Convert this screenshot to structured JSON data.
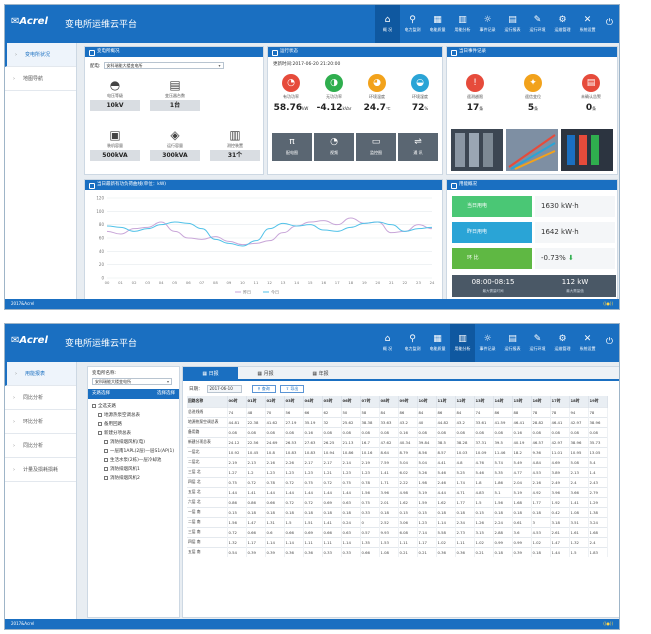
{
  "app": {
    "logo": "Acrel",
    "title": "变电所运维云平台",
    "footer": "2017&Acrel"
  },
  "nav": [
    {
      "label": "概 况",
      "icon": "⌂"
    },
    {
      "label": "电力监测",
      "icon": "⚲"
    },
    {
      "label": "电能质量",
      "icon": "▦"
    },
    {
      "label": "用能分析",
      "icon": "▥"
    },
    {
      "label": "事件记录",
      "icon": "☼"
    },
    {
      "label": "运行报表",
      "icon": "▤"
    },
    {
      "label": "运行环境",
      "icon": "✎"
    },
    {
      "label": "运维管理",
      "icon": "⚙"
    },
    {
      "label": "系统设置",
      "icon": "✕"
    }
  ],
  "screen1": {
    "sidebar": [
      {
        "label": "变电所状况"
      },
      {
        "label": "地图导航"
      }
    ],
    "overview": {
      "title": "变电所概况",
      "room_label": "配电:",
      "room_value": "安科瑞能大楼变电所",
      "items": [
        {
          "label": "电压等级",
          "value": "10kV"
        },
        {
          "label": "变压器台数",
          "value": "1台"
        },
        {
          "label": "装机容量",
          "value": "500kVA"
        },
        {
          "label": "运行容量",
          "value": "300kVA"
        },
        {
          "label": "测控装置",
          "value": "31个"
        }
      ]
    },
    "running": {
      "title": "运行状态",
      "time_label": "更新时间:",
      "time_value": "2017-06-20 21:20:00",
      "metrics": [
        {
          "label": "有功功率",
          "value": "58.76",
          "unit": "kW",
          "color": "#e64b3b"
        },
        {
          "label": "无功功率",
          "value": "-4.12",
          "unit": "kVar",
          "color": "#2fae4e"
        },
        {
          "label": "环境温度",
          "value": "24.7",
          "unit": "℃",
          "color": "#f2a21b"
        },
        {
          "label": "环境湿度",
          "value": "72",
          "unit": "%",
          "color": "#2aa4d6"
        }
      ],
      "tiles": [
        {
          "label": "配电图",
          "icon": "π"
        },
        {
          "label": "视频",
          "icon": "◔"
        },
        {
          "label": "监控图",
          "icon": "▭"
        },
        {
          "label": "通 讯",
          "icon": "⇌"
        }
      ]
    },
    "events": {
      "title": "当日事件记录",
      "items": [
        {
          "label": "遥测越限",
          "value": "17",
          "unit": "条",
          "color": "#e64b3b"
        },
        {
          "label": "遥信变位",
          "value": "5",
          "unit": "条",
          "color": "#f2a21b"
        },
        {
          "label": "未确认告警",
          "value": "0",
          "unit": "条",
          "color": "#e64b3b"
        }
      ]
    },
    "load_chart": {
      "title": "当日最新有功负荷曲线(单位：kW)"
    },
    "chart_data": {
      "type": "line",
      "x": [
        "00",
        "01",
        "02",
        "03",
        "04",
        "05",
        "06",
        "07",
        "08",
        "09",
        "10",
        "11",
        "12",
        "13",
        "14",
        "15",
        "16",
        "17",
        "18",
        "19",
        "20",
        "21",
        "22",
        "23",
        "24"
      ],
      "ylim": [
        0,
        120
      ],
      "yticks": [
        0,
        20,
        40,
        60,
        80,
        100,
        120
      ],
      "series": [
        {
          "name": "昨日",
          "color": "#c8a6d8",
          "values": [
            70,
            66,
            74,
            76,
            84,
            70,
            60,
            58,
            62,
            55,
            50,
            52,
            56,
            68,
            78,
            84,
            86,
            80,
            90,
            82,
            84,
            68,
            70,
            80,
            74
          ]
        },
        {
          "name": "今日",
          "color": "#52c2e8",
          "values": [
            78,
            76,
            70,
            74,
            80,
            84,
            82,
            74,
            58,
            52,
            48,
            56,
            74,
            82,
            78,
            80,
            72,
            70,
            76,
            82,
            84,
            80,
            70,
            74,
            76
          ]
        }
      ],
      "legend_position": "bottom"
    },
    "energy": {
      "title": "用能概况",
      "today_label": "当日用电",
      "today_value": "1630 kW·h",
      "yesterday_label": "昨日用电",
      "yesterday_value": "1642 kW·h",
      "ratio_label": "环 比",
      "ratio_value": "-0.73%",
      "peak_time": "08:00-08:15",
      "peak_time_label": "最大需量时间",
      "peak_value": "112 kW",
      "peak_value_label": "最大需量值"
    }
  },
  "screen2": {
    "sidebar": [
      {
        "label": "用能报表"
      },
      {
        "label": "同比分析"
      },
      {
        "label": "环比分析"
      },
      {
        "label": "同比分析"
      },
      {
        "label": "计量及损耗损耗"
      }
    ],
    "tree": {
      "room_label": "变电所名称:",
      "room_value": "安科瑞能大楼变电所",
      "header_left": "支路选择",
      "header_right": "选择选择",
      "nodes": [
        {
          "label": "全选支路",
          "indent": 0
        },
        {
          "label": "地源热泵空调总表",
          "indent": 1
        },
        {
          "label": "备用回路",
          "indent": 1
        },
        {
          "label": "新建分项总表",
          "indent": 1
        },
        {
          "label": "消防排烟风机(电)",
          "indent": 2
        },
        {
          "label": "一层南1APL(2层)—层S1(AP(1)",
          "indent": 2
        },
        {
          "label": "生活水泵(2栋)—层冷却池",
          "indent": 2
        },
        {
          "label": "消防排烟风机1",
          "indent": 2
        },
        {
          "label": "消防排烟风机2",
          "indent": 2
        }
      ]
    },
    "tabs": [
      {
        "label": "日报",
        "icon": "▦"
      },
      {
        "label": "月报",
        "icon": "▦"
      },
      {
        "label": "年报",
        "icon": "▦"
      }
    ],
    "query": {
      "date_label": "日期：",
      "date_value": "2017-06-10",
      "query_button": "查询",
      "export_button": "导出"
    },
    "table": {
      "columns": [
        "回路名称",
        "00时",
        "01时",
        "02时",
        "03时",
        "04时",
        "05时",
        "06时",
        "07时",
        "08时",
        "09时",
        "10时",
        "11时",
        "12时",
        "13时",
        "14时",
        "15时",
        "16时",
        "17时",
        "18时",
        "19时"
      ],
      "rows": [
        [
          "总进线线",
          74,
          48,
          70,
          56,
          66,
          62,
          50,
          58,
          84,
          86,
          84,
          86,
          84,
          74,
          86,
          88,
          78,
          78,
          94,
          78
        ],
        [
          "地源热泵空调总表",
          "44.81",
          "22.38",
          "41.62",
          "27.19",
          "35.19",
          "32",
          "25.62",
          "38.38",
          "33.63",
          "43.2",
          "40",
          "44.82",
          "43.2",
          "33.61",
          "41.59",
          "46.41",
          "28.82",
          "46.41",
          "42.97",
          "38.96"
        ],
        [
          "备用路",
          "0.08",
          "0.08",
          "0.08",
          "0.08",
          "0.16",
          "0.08",
          "0.08",
          "0.08",
          "0.08",
          "0.16",
          "0.08",
          "0.08",
          "0.08",
          "0.08",
          "0.08",
          "0.16",
          "0.08",
          "0.08",
          "0.08",
          "0.08"
        ],
        [
          "新建分项总表",
          "24.12",
          "22.56",
          "24.69",
          "26.53",
          "27.63",
          "26.25",
          "21.13",
          "16.7",
          "47.62",
          "40.34",
          "39.84",
          "38.5",
          "38.28",
          "37.31",
          "39.5",
          "40.19",
          "46.57",
          "42.97",
          "38.96",
          "35.73"
        ],
        [
          "一层北",
          "10.92",
          "10.45",
          "10.8",
          "10.83",
          "10.83",
          "10.94",
          "10.86",
          "10.16",
          "8.64",
          "8.79",
          "8.56",
          "8.57",
          "10.03",
          "10.09",
          "11.46",
          "18.2",
          "9.36",
          "11.01",
          "10.95",
          "13.05"
        ],
        [
          "二层北",
          "2.19",
          "2.13",
          "2.16",
          "2.26",
          "2.17",
          "2.17",
          "2.14",
          "2.19",
          "7.59",
          "5.04",
          "5.04",
          "4.41",
          "4.8",
          "4.76",
          "5.74",
          "5.49",
          "4.84",
          "4.69",
          "5.08",
          "5.4"
        ],
        [
          "三层 北",
          "1.27",
          "1.2",
          "1.23",
          "1.23",
          "1.23",
          "1.21",
          "1.23",
          "1.23",
          "1.41",
          "6.02",
          "5.26",
          "5.46",
          "5.25",
          "5.46",
          "5.35",
          "4.77",
          "4.53",
          "3.89",
          "2.13",
          "1.4"
        ],
        [
          "四层 北",
          "0.75",
          "0.72",
          "0.78",
          "0.72",
          "0.75",
          "0.72",
          "0.75",
          "0.78",
          "1.71",
          "2.22",
          "1.98",
          "2.46",
          "1.74",
          "1.8",
          "1.86",
          "2.04",
          "2.16",
          "2.49",
          "2.4",
          "2.43"
        ],
        [
          "五层 北",
          "1.44",
          "1.41",
          "1.44",
          "1.44",
          "1.44",
          "1.44",
          "1.44",
          "1.56",
          "3.96",
          "4.98",
          "5.19",
          "4.44",
          "4.71",
          "4.83",
          "5.1",
          "5.19",
          "4.92",
          "3.96",
          "3.66",
          "2.79"
        ],
        [
          "六层 北",
          "0.86",
          "0.86",
          "0.66",
          "0.72",
          "0.72",
          "0.69",
          "0.63",
          "0.75",
          "2.01",
          "1.62",
          "1.59",
          "1.62",
          "1.77",
          "1.5",
          "1.56",
          "1.68",
          "1.77",
          "1.92",
          "1.41",
          "1.29"
        ],
        [
          "一层 南",
          "0.15",
          "0.18",
          "0.18",
          "0.18",
          "0.18",
          "0.18",
          "0.18",
          "0.33",
          "0.18",
          "0.15",
          "0.15",
          "0.18",
          "0.18",
          "0.15",
          "0.18",
          "0.18",
          "0.18",
          "0.42",
          "1.08",
          "1.38"
        ],
        [
          "二层 南",
          "1.56",
          "1.47",
          "1.31",
          "1.5",
          "1.51",
          "1.41",
          "0.24",
          "0",
          "2.52",
          "3.06",
          "1.23",
          "1.14",
          "2.34",
          "1.26",
          "2.24",
          "0.61",
          "3",
          "3.18",
          "3.51",
          "3.24"
        ],
        [
          "三层 南",
          "0.72",
          "0.66",
          "0.6",
          "0.66",
          "0.69",
          "0.66",
          "0.63",
          "0.57",
          "9.93",
          "6.08",
          "7.14",
          "5.58",
          "2.73",
          "3.15",
          "2.88",
          "3.6",
          "4.53",
          "2.61",
          "1.61",
          "1.68"
        ],
        [
          "四层 南",
          "1.32",
          "1.17",
          "1.14",
          "1.14",
          "1.11",
          "1.11",
          "1.14",
          "1.35",
          "1.53",
          "1.11",
          "1.17",
          "1.02",
          "1.11",
          "1.02",
          "0.99",
          "0.99",
          "1.02",
          "1.47",
          "1.32",
          "2.4"
        ],
        [
          "五层 南",
          "0.54",
          "0.39",
          "0.39",
          "0.36",
          "0.36",
          "0.33",
          "0.33",
          "0.66",
          "1.08",
          "0.21",
          "0.21",
          "0.36",
          "0.36",
          "0.21",
          "0.18",
          "0.39",
          "0.18",
          "1.44",
          "1.5",
          "1.83"
        ]
      ]
    }
  }
}
